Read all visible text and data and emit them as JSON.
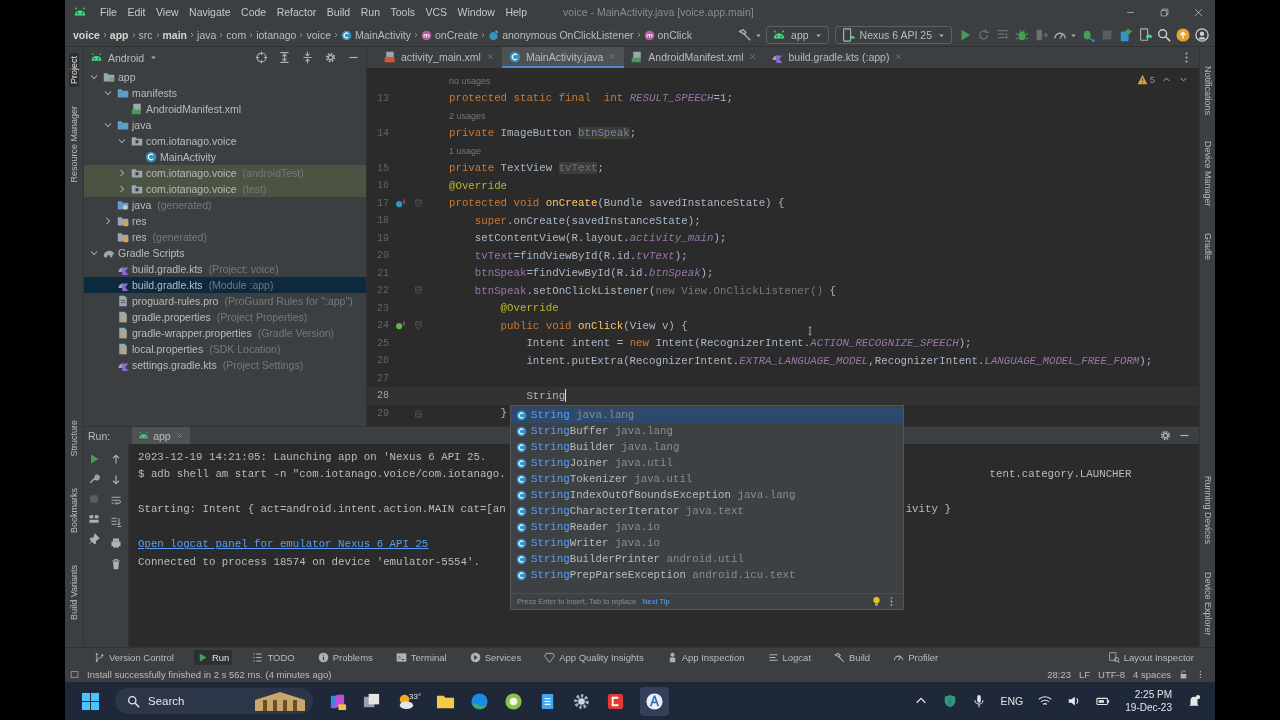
{
  "title_bar": {
    "menus": [
      "File",
      "Edit",
      "View",
      "Navigate",
      "Code",
      "Refactor",
      "Build",
      "Run",
      "Tools",
      "VCS",
      "Window",
      "Help"
    ],
    "title": "voice - MainActivity.java [voice.app.main]"
  },
  "nav_bar": {
    "breadcrumbs": [
      {
        "label": "voice",
        "bold": true,
        "kind": "plain"
      },
      {
        "label": "app",
        "bold": true,
        "kind": "plain"
      },
      {
        "label": "src",
        "bold": false,
        "kind": "plain"
      },
      {
        "label": "main",
        "bold": true,
        "kind": "plain"
      },
      {
        "label": "java",
        "bold": false,
        "kind": "plain"
      },
      {
        "label": "com",
        "bold": false,
        "kind": "plain"
      },
      {
        "label": "iotanago",
        "bold": false,
        "kind": "plain"
      },
      {
        "label": "voice",
        "bold": false,
        "kind": "plain"
      },
      {
        "label": "MainActivity",
        "bold": false,
        "kind": "class"
      },
      {
        "label": "onCreate",
        "bold": false,
        "kind": "method"
      },
      {
        "label": "anonymous OnClickListener",
        "bold": false,
        "kind": "anonymous"
      },
      {
        "label": "onClick",
        "bold": false,
        "kind": "method"
      }
    ],
    "run_config": "app",
    "device": "Nexus 6 API 25"
  },
  "left_stripe": {
    "top": [
      {
        "label": "Project",
        "selected": true
      },
      {
        "label": "Resource Manager",
        "selected": false
      }
    ],
    "bottom": [
      "Structure",
      "Bookmarks",
      "Build Variants"
    ]
  },
  "right_stripe": {
    "top": [
      "Notifications",
      "Device Manager",
      "Gradle"
    ],
    "bottom": [
      "Running Devices",
      "Device Explorer"
    ]
  },
  "project_panel": {
    "view": "Android",
    "tree": [
      {
        "label": "app",
        "kind": "module",
        "expanded": true,
        "selected": false,
        "tinted": false,
        "children": [
          {
            "label": "manifests",
            "kind": "folder",
            "expanded": true,
            "selected": false,
            "tinted": false,
            "children": [
              {
                "label": "AndroidManifest.xml",
                "kind": "manifest",
                "selected": false,
                "tinted": false
              }
            ]
          },
          {
            "label": "java",
            "kind": "folder",
            "expanded": true,
            "selected": false,
            "tinted": false,
            "children": [
              {
                "label": "com.iotanago.voice",
                "kind": "package",
                "expanded": true,
                "selected": false,
                "tinted": false,
                "children": [
                  {
                    "label": "MainActivity",
                    "kind": "class",
                    "selected": false,
                    "tinted": false
                  }
                ]
              },
              {
                "label": "com.iotanago.voice",
                "note": "(androidTest)",
                "kind": "package",
                "expanded": false,
                "selected": false,
                "tinted": true
              },
              {
                "label": "com.iotanago.voice",
                "note": "(test)",
                "kind": "package",
                "expanded": false,
                "selected": false,
                "tinted": true
              }
            ]
          },
          {
            "label": "java",
            "note": "(generated)",
            "kind": "generated",
            "selected": false,
            "tinted": false
          },
          {
            "label": "res",
            "kind": "res",
            "expanded": false,
            "selected": false,
            "tinted": false
          },
          {
            "label": "res",
            "note": "(generated)",
            "kind": "res",
            "selected": false,
            "tinted": false
          }
        ]
      },
      {
        "label": "Gradle Scripts",
        "kind": "gradle",
        "expanded": true,
        "selected": false,
        "tinted": false,
        "children": [
          {
            "label": "build.gradle.kts",
            "note": "(Project: voice)",
            "kind": "kts",
            "selected": false,
            "tinted": false
          },
          {
            "label": "build.gradle.kts",
            "note": "(Module :app)",
            "kind": "kts",
            "selected": true,
            "tinted": false
          },
          {
            "label": "proguard-rules.pro",
            "note": "(ProGuard Rules for \":app\")",
            "kind": "file",
            "selected": false,
            "tinted": false
          },
          {
            "label": "gradle.properties",
            "note": "(Project Properties)",
            "kind": "properties",
            "selected": false,
            "tinted": false
          },
          {
            "label": "gradle-wrapper.properties",
            "note": "(Gradle Version)",
            "kind": "properties",
            "selected": false,
            "tinted": false
          },
          {
            "label": "local.properties",
            "note": "(SDK Location)",
            "kind": "properties",
            "selected": false,
            "tinted": false
          },
          {
            "label": "settings.gradle.kts",
            "note": "(Project Settings)",
            "kind": "kts",
            "selected": false,
            "tinted": false
          }
        ]
      }
    ]
  },
  "editor": {
    "tabs": [
      {
        "label": "activity_main.xml",
        "kind": "xml",
        "selected": false
      },
      {
        "label": "MainActivity.java",
        "kind": "class",
        "selected": true
      },
      {
        "label": "AndroidManifest.xml",
        "kind": "manifest",
        "selected": false
      },
      {
        "label": "build.gradle.kts (:app)",
        "kind": "kts",
        "selected": false
      }
    ],
    "warnings": "5",
    "lines": [
      {
        "kind": "hint",
        "text": "no usages"
      },
      {
        "kind": "code",
        "number": "13",
        "current": false,
        "tokens": [
          {
            "kind": "keyword",
            "text": "protected static final  int "
          },
          {
            "kind": "constant",
            "text": "RESULT_SPEECH"
          },
          {
            "kind": "plain",
            "text": "=1;"
          }
        ]
      },
      {
        "kind": "hint",
        "text": "2 usages"
      },
      {
        "kind": "code",
        "number": "14",
        "current": false,
        "tokens": [
          {
            "kind": "keyword",
            "text": "private "
          },
          {
            "kind": "plain",
            "text": "ImageButton "
          },
          {
            "kind": "usage",
            "text": "btnSpeak"
          },
          {
            "kind": "plain",
            "text": ";"
          }
        ]
      },
      {
        "kind": "hint",
        "text": "1 usage"
      },
      {
        "kind": "code",
        "number": "15",
        "current": false,
        "tokens": [
          {
            "kind": "keyword",
            "text": "private "
          },
          {
            "kind": "plain",
            "text": "TextView "
          },
          {
            "kind": "unused",
            "text": "tvText"
          },
          {
            "kind": "plain",
            "text": ";"
          }
        ]
      },
      {
        "kind": "code",
        "number": "16",
        "current": false,
        "tokens": [
          {
            "kind": "annotation",
            "text": "@Override"
          }
        ]
      },
      {
        "kind": "code",
        "number": "17",
        "current": false,
        "overrides": true,
        "foldable": true,
        "tokens": [
          {
            "kind": "keyword",
            "text": "protected void "
          },
          {
            "kind": "method",
            "text": "onCreate"
          },
          {
            "kind": "plain",
            "text": "(Bundle savedInstanceState) {"
          }
        ],
        "children": [
          {
            "kind": "code",
            "number": "18",
            "current": false,
            "tokens": [
              {
                "kind": "keyword",
                "text": "super"
              },
              {
                "kind": "plain",
                "text": ".onCreate(savedInstanceState);"
              }
            ]
          },
          {
            "kind": "code",
            "number": "19",
            "current": false,
            "tokens": [
              {
                "kind": "plain",
                "text": "setContentView(R.layout."
              },
              {
                "kind": "constant",
                "text": "activity_main"
              },
              {
                "kind": "plain",
                "text": ");"
              }
            ]
          },
          {
            "kind": "code",
            "number": "20",
            "current": false,
            "tokens": [
              {
                "kind": "field",
                "text": "tvText"
              },
              {
                "kind": "plain",
                "text": "=findViewById(R.id."
              },
              {
                "kind": "constant",
                "text": "tvText"
              },
              {
                "kind": "plain",
                "text": ");"
              }
            ]
          },
          {
            "kind": "code",
            "number": "21",
            "current": false,
            "tokens": [
              {
                "kind": "field",
                "text": "btnSpeak"
              },
              {
                "kind": "plain",
                "text": "=findViewById(R.id."
              },
              {
                "kind": "constant",
                "text": "btnSpeak"
              },
              {
                "kind": "plain",
                "text": ");"
              }
            ]
          },
          {
            "kind": "code",
            "number": "22",
            "current": false,
            "foldable": true,
            "tokens": [
              {
                "kind": "field",
                "text": "btnSpeak"
              },
              {
                "kind": "plain",
                "text": ".setOnClickListener("
              },
              {
                "kind": "dim",
                "text": "new View.OnClickListener()"
              },
              {
                "kind": "plain",
                "text": " {"
              }
            ],
            "children": [
              {
                "kind": "code",
                "number": "23",
                "current": false,
                "tokens": [
                  {
                    "kind": "annotation",
                    "text": "@Override"
                  }
                ]
              },
              {
                "kind": "code",
                "number": "24",
                "current": false,
                "implements": true,
                "foldable": true,
                "tokens": [
                  {
                    "kind": "keyword",
                    "text": "public void "
                  },
                  {
                    "kind": "method",
                    "text": "onClick"
                  },
                  {
                    "kind": "plain",
                    "text": "(View v) {"
                  }
                ],
                "children": [
                  {
                    "kind": "code",
                    "number": "25",
                    "current": false,
                    "tokens": [
                      {
                        "kind": "plain",
                        "text": "Intent intent = "
                      },
                      {
                        "kind": "keyword",
                        "text": "new "
                      },
                      {
                        "kind": "plain",
                        "text": "Intent(RecognizerIntent."
                      },
                      {
                        "kind": "constant",
                        "text": "ACTION_RECOGNIZE_SPEECH"
                      },
                      {
                        "kind": "plain",
                        "text": ");"
                      }
                    ]
                  },
                  {
                    "kind": "code",
                    "number": "26",
                    "current": false,
                    "tokens": [
                      {
                        "kind": "plain",
                        "text": "intent.putExtra(RecognizerIntent."
                      },
                      {
                        "kind": "constant",
                        "text": "EXTRA_LANGUAGE_MODEL"
                      },
                      {
                        "kind": "plain",
                        "text": ",RecognizerIntent."
                      },
                      {
                        "kind": "constant",
                        "text": "LANGUAGE_MODEL_FREE_FORM"
                      },
                      {
                        "kind": "plain",
                        "text": ");"
                      }
                    ]
                  },
                  {
                    "kind": "code",
                    "number": "27",
                    "current": false
                  },
                  {
                    "kind": "code",
                    "number": "28",
                    "current": true,
                    "tokens": [
                      {
                        "kind": "plain",
                        "text": "String"
                      }
                    ]
                  }
                ]
              },
              {
                "kind": "code",
                "number": "29",
                "current": false,
                "fold_end": true,
                "tokens": [
                  {
                    "kind": "plain",
                    "text": "}"
                  }
                ]
              }
            ]
          }
        ]
      }
    ]
  },
  "completion": {
    "items": [
      {
        "match": "String",
        "package": "java.lang",
        "selected": true
      },
      {
        "match": "String",
        "rest": "Buffer",
        "package": "java.lang",
        "selected": false
      },
      {
        "match": "String",
        "rest": "Builder",
        "package": "java.lang",
        "selected": false
      },
      {
        "match": "String",
        "rest": "Joiner",
        "package": "java.util",
        "selected": false
      },
      {
        "match": "String",
        "rest": "Tokenizer",
        "package": "java.util",
        "selected": false
      },
      {
        "match": "String",
        "rest": "IndexOutOfBoundsException",
        "package": "java.lang",
        "selected": false
      },
      {
        "match": "String",
        "rest": "CharacterIterator",
        "package": "java.text",
        "selected": false
      },
      {
        "match": "String",
        "rest": "Reader",
        "package": "java.io",
        "selected": false
      },
      {
        "match": "String",
        "rest": "Writer",
        "package": "java.io",
        "selected": false
      },
      {
        "match": "String",
        "rest": "BuilderPrinter",
        "package": "android.util",
        "selected": false
      },
      {
        "match": "String",
        "rest": "PrepParseException",
        "package": "android.icu.text",
        "selected": false
      }
    ],
    "hint": "Press Enter to insert, Tab to replace.",
    "tip_link": "Next Tip"
  },
  "run_panel": {
    "label": "Run:",
    "tab": "app",
    "console": [
      {
        "kind": "text",
        "left": "2023-12-19 14:21:05: Launching app on 'Nexus 6 API 25."
      },
      {
        "kind": "text",
        "left": "$ adb shell am start -n \"com.iotanago.voice/com.iotanago.",
        "right": "tent.category.LAUNCHER"
      },
      {
        "kind": "blank"
      },
      {
        "kind": "text",
        "left": "Starting: Intent { act=android.intent.action.MAIN cat=[an",
        "right": "ivity }"
      },
      {
        "kind": "blank"
      },
      {
        "kind": "link",
        "left": "Open logcat panel for emulator Nexus 6 API 25"
      },
      {
        "kind": "text",
        "left": "Connected to process 18574 on device 'emulator-5554'."
      }
    ]
  },
  "tool_windows": [
    {
      "label": "Version Control",
      "selected": false
    },
    {
      "label": "Run",
      "selected": true
    },
    {
      "label": "TODO",
      "selected": false
    },
    {
      "label": "Problems",
      "selected": false
    },
    {
      "label": "Terminal",
      "selected": false
    },
    {
      "label": "Services",
      "selected": false
    },
    {
      "label": "App Quality Insights",
      "selected": false
    },
    {
      "label": "App Inspection",
      "selected": false
    },
    {
      "label": "Logcat",
      "selected": false
    },
    {
      "label": "Build",
      "selected": false
    },
    {
      "label": "Profiler",
      "selected": false
    }
  ],
  "layout_inspector": "Layout Inspector",
  "status_bar": {
    "message": "Install successfully finished in 2 s 562 ms. (4 minutes ago)",
    "items": [
      "28:23",
      "LF",
      "UTF-8",
      "4 spaces"
    ]
  },
  "taskbar": {
    "search": "Search",
    "weather": "33°",
    "language": "ENG",
    "time": "2:25 PM",
    "date": "19-Dec-23"
  }
}
